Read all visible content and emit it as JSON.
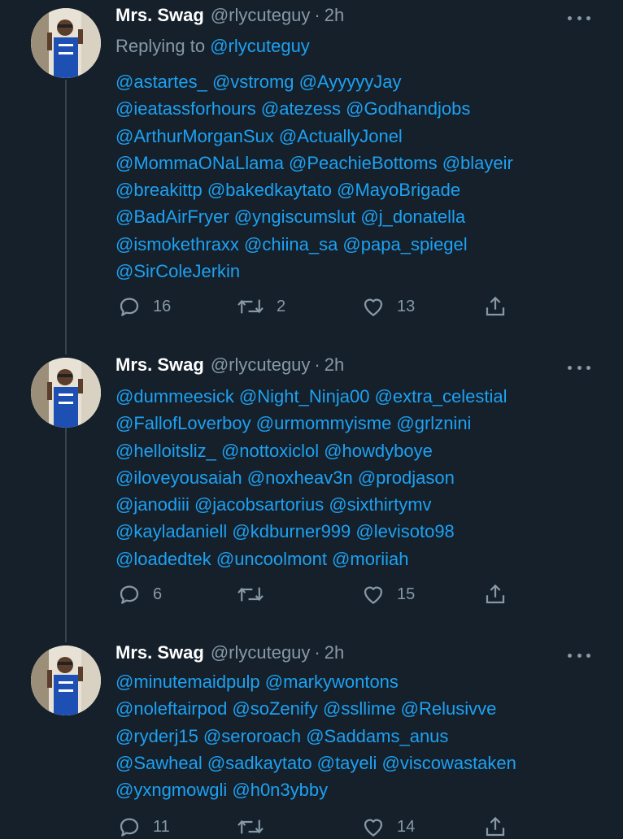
{
  "tweets": [
    {
      "name": "Mrs. Swag",
      "handle": "@rlycuteguy",
      "time": "2h",
      "replying_prefix": "Replying to",
      "replying_handle": "@rlycuteguy",
      "lines": [
        "@astartes_ @vstromg @AyyyyyJay",
        "@ieatassforhours @atezess @Godhandjobs",
        "@ArthurMorganSux @ActuallyJonel",
        "@MommaONaLlama @PeachieBottoms @blayeir",
        "@breakittp @bakedkaytato @MayoBrigade",
        "@BadAirFryer @yngiscumslut @j_donatella",
        "@ismokethraxx @chiina_sa @papa_spiegel",
        "@SirColeJerkin"
      ],
      "replies": "16",
      "retweets": "2",
      "likes": "13"
    },
    {
      "name": "Mrs. Swag",
      "handle": "@rlycuteguy",
      "time": "2h",
      "lines": [
        "@dummeesick @Night_Ninja00 @extra_celestial",
        "@FallofLoverboy @urmommyisme @grlznini",
        "@helloitsliz_ @nottoxiclol @howdyboye",
        "@iloveyousaiah @noxheav3n @prodjason",
        "@janodiii @jacobsartorius @sixthirtymv",
        "@kayladaniell @kdburner999 @levisoto98",
        "@loadedtek @uncoolmont @moriiah"
      ],
      "replies": "6",
      "retweets": "",
      "likes": "15"
    },
    {
      "name": "Mrs. Swag",
      "handle": "@rlycuteguy",
      "time": "2h",
      "lines": [
        "@minutemaidpulp @markywontons",
        "@noleftairpod @soZenify @ssllime @Relusivve",
        "@ryderj15 @seroroach @Saddams_anus",
        "@Sawheal @sadkaytato @tayeli @viscowastaken",
        "@yxngmowgli @h0n3ybby"
      ],
      "replies": "11",
      "retweets": "",
      "likes": "14"
    }
  ],
  "icons": {
    "reply": "reply-icon",
    "retweet": "retweet-icon",
    "like": "heart-icon",
    "share": "share-icon",
    "more": "more-options-icon"
  },
  "colors": {
    "background": "#15202b",
    "link": "#1da1f2",
    "muted": "#8899a6",
    "name": "#ffffff",
    "thread_line": "#38444d"
  }
}
